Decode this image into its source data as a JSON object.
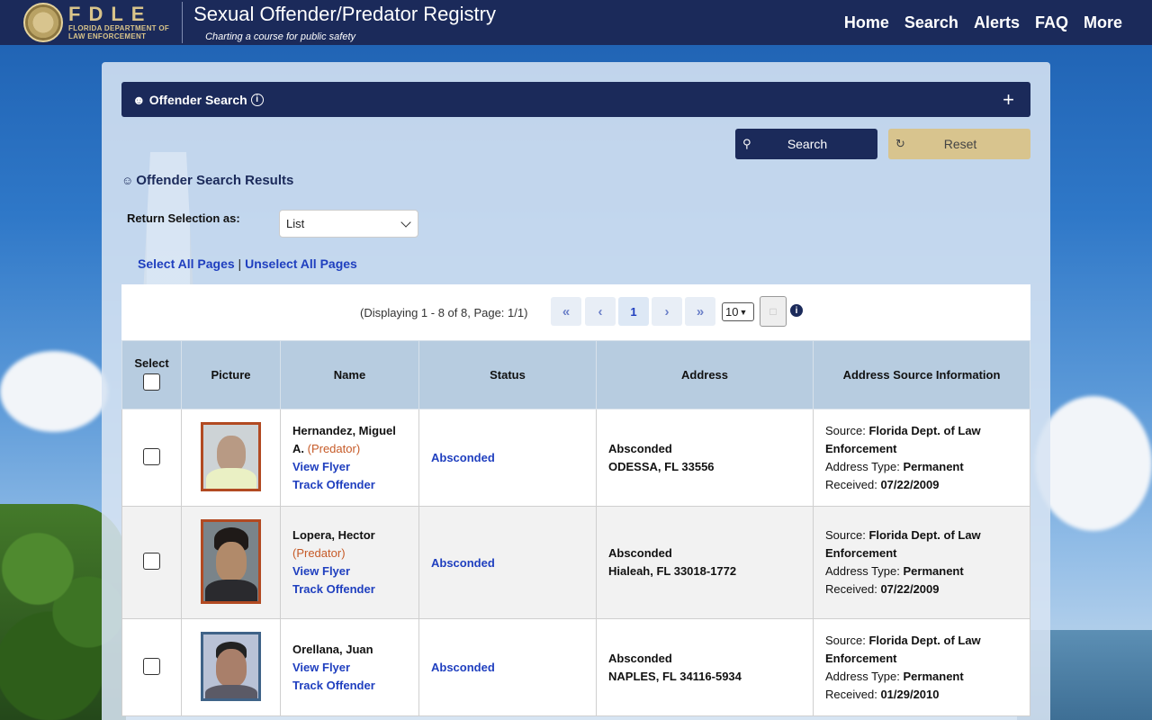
{
  "header": {
    "logo_text": "FDLE",
    "logo_subtext_1": "FLORIDA DEPARTMENT OF",
    "logo_subtext_2": "LAW ENFORCEMENT",
    "site_title": "Sexual Offender/Predator Registry",
    "tagline": "Charting a course for public safety",
    "nav": [
      "Home",
      "Search",
      "Alerts",
      "FAQ",
      "More"
    ]
  },
  "search_panel": {
    "title": "Offender Search",
    "search_button": "Search",
    "reset_button": "Reset"
  },
  "results": {
    "title": "Offender Search Results",
    "return_label": "Return Selection as:",
    "return_value": "List",
    "select_all": "Select All Pages",
    "separator": "|",
    "unselect_all": "Unselect All Pages"
  },
  "pager": {
    "display_text": "(Displaying 1 - 8 of 8, Page: 1/1)",
    "first": "«",
    "prev": "‹",
    "current_page": "1",
    "next": "›",
    "last": "»",
    "page_size": "10"
  },
  "table": {
    "headers": {
      "select": "Select",
      "picture": "Picture",
      "name": "Name",
      "status": "Status",
      "address": "Address",
      "source": "Address Source Information"
    },
    "labels": {
      "source": "Source:",
      "address_type": "Address Type:",
      "received": "Received:"
    },
    "rows": [
      {
        "name": "Hernandez, Miguel A.",
        "designation": "(Predator)",
        "view_flyer": "View Flyer",
        "track": "Track Offender",
        "status": "Absconded",
        "address_line1": "Absconded",
        "address_line2": "ODESSA, FL 33556",
        "source": "Florida Dept. of Law Enforcement",
        "address_type": "Permanent",
        "received": "07/22/2009"
      },
      {
        "name": "Lopera, Hector",
        "designation": "(Predator)",
        "view_flyer": "View Flyer",
        "track": "Track Offender",
        "status": "Absconded",
        "address_line1": "Absconded",
        "address_line2": "Hialeah, FL 33018-1772",
        "source": "Florida Dept. of Law Enforcement",
        "address_type": "Permanent",
        "received": "07/22/2009"
      },
      {
        "name": "Orellana, Juan",
        "designation": "",
        "view_flyer": "View Flyer",
        "track": "Track Offender",
        "status": "Absconded",
        "address_line1": "Absconded",
        "address_line2": "NAPLES, FL 34116-5934",
        "source": "Florida Dept. of Law Enforcement",
        "address_type": "Permanent",
        "received": "01/29/2010"
      }
    ]
  },
  "colors": {
    "navy": "#1b2a5a",
    "gold": "#d8c48e",
    "link": "#1f3fbf",
    "predator": "#c65a27"
  }
}
